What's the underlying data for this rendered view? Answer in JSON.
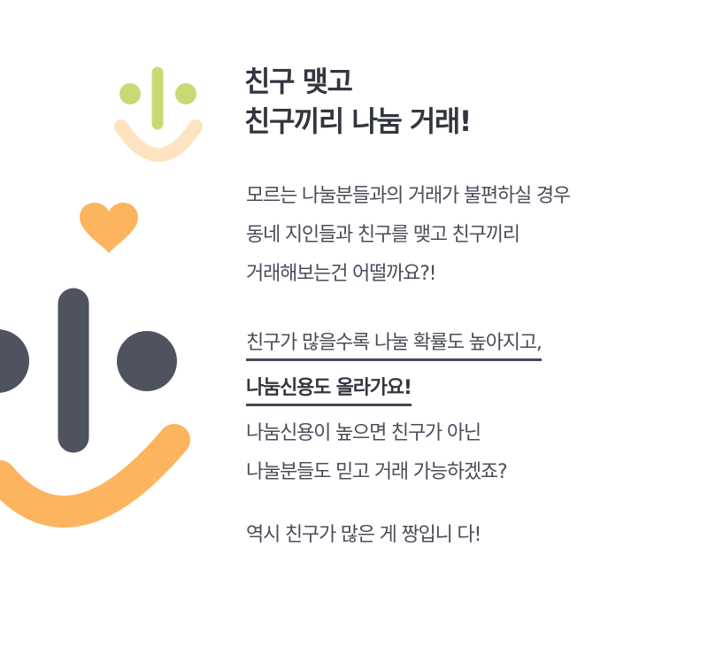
{
  "heading": {
    "line1": "친구 맺고",
    "line2": "친구끼리 나눔 거래!"
  },
  "paragraph1": {
    "line1": "모르는 나눌분들과의 거래가 불편하실 경우",
    "line2": "동네 지인들과 친구를 맺고 친구끼리",
    "line3": "거래해보는건 어떨까요?!"
  },
  "paragraph2": {
    "line1": "친구가 많을수록 나눌 확률도 높아지고,",
    "line2": "나눔신용도 올라가요!",
    "line3": "나눔신용이 높으면 친구가 아닌",
    "line4": "나눌분들도 믿고 거래 가능하겠죠?"
  },
  "paragraph3": {
    "line1": "역시 친구가 많은 게 짱입니 다!"
  },
  "colors": {
    "small_face_features": "#c9da74",
    "small_face_smile": "#fde3bf",
    "heart": "#fdb45f",
    "big_face_features": "#4f5360",
    "big_face_smile": "#fdb45f"
  },
  "icons": [
    "small-smiley-icon",
    "heart-icon",
    "big-smiley-icon"
  ]
}
